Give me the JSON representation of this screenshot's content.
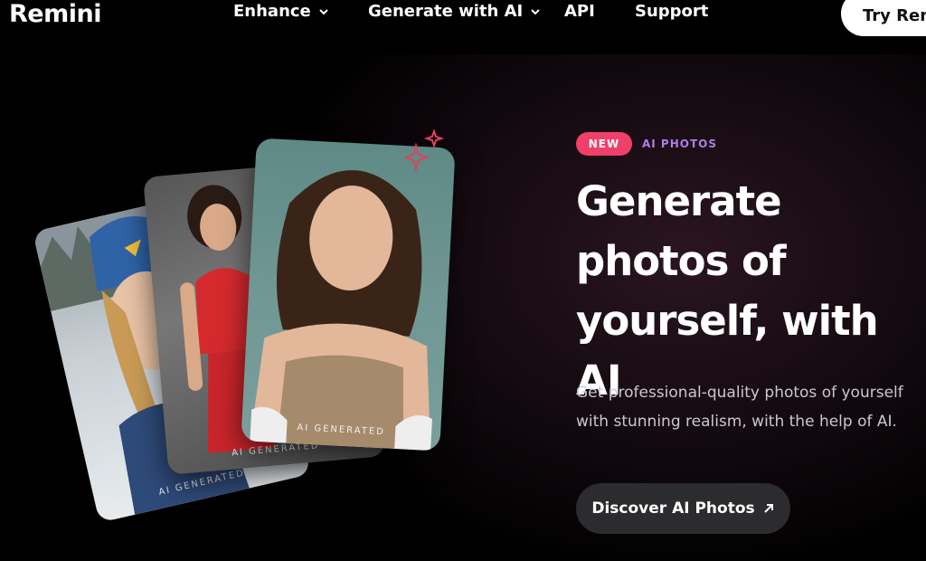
{
  "nav": {
    "logo": "Remini",
    "items": [
      {
        "label": "Enhance",
        "has_dropdown": true
      },
      {
        "label": "Generate with AI",
        "has_dropdown": true
      },
      {
        "label": "API",
        "has_dropdown": false
      },
      {
        "label": "Support",
        "has_dropdown": false
      }
    ],
    "cta_label": "Try Rem"
  },
  "cards": [
    {
      "watermark": "AI GENERATED"
    },
    {
      "watermark": "AI GENERATED"
    },
    {
      "watermark": "AI GENERATED"
    }
  ],
  "hero": {
    "badge": "NEW",
    "category": "AI PHOTOS",
    "headline": "Generate photos of yourself, with AI",
    "subtext": "Get professional-quality photos of yourself with stunning realism, with the help of AI.",
    "button_label": "Discover AI Photos"
  },
  "colors": {
    "badge_bg": "#f0406a",
    "category_text": "#b07de8",
    "sparkle": "#e0425e"
  }
}
